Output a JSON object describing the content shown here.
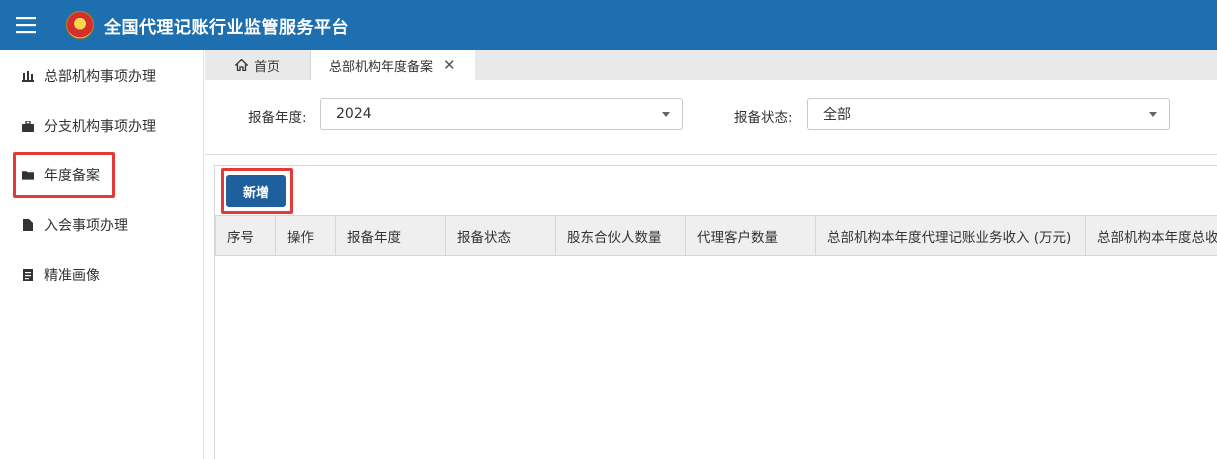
{
  "header": {
    "title": "全国代理记账行业监管服务平台",
    "menu_icon": "hamburger-menu-icon",
    "emblem_icon": "national-emblem-icon",
    "bg_color": "#1e6fb0"
  },
  "sidebar": {
    "items": [
      {
        "label": "总部机构事项办理",
        "icon": "bank-icon"
      },
      {
        "label": "分支机构事项办理",
        "icon": "briefcase-icon"
      },
      {
        "label": "年度备案",
        "icon": "folder-icon",
        "active": true
      },
      {
        "label": "入会事项办理",
        "icon": "document-icon"
      },
      {
        "label": "精准画像",
        "icon": "list-document-icon"
      }
    ]
  },
  "tabs": {
    "home": {
      "label": "首页",
      "icon": "home-icon"
    },
    "active": {
      "label": "总部机构年度备案",
      "close_icon": "close-icon"
    }
  },
  "filters": {
    "year_label": "报备年度:",
    "year_value": "2024",
    "status_label": "报备状态:",
    "status_value": "全部"
  },
  "toolbar": {
    "add_label": "新增",
    "highlight_color": "#e53935"
  },
  "table": {
    "columns": [
      "序号",
      "操作",
      "报备年度",
      "报备状态",
      "股东合伙人数量",
      "代理客户数量",
      "总部机构本年度代理记账业务收入 (万元)",
      "总部机构本年度总收"
    ],
    "rows": []
  }
}
